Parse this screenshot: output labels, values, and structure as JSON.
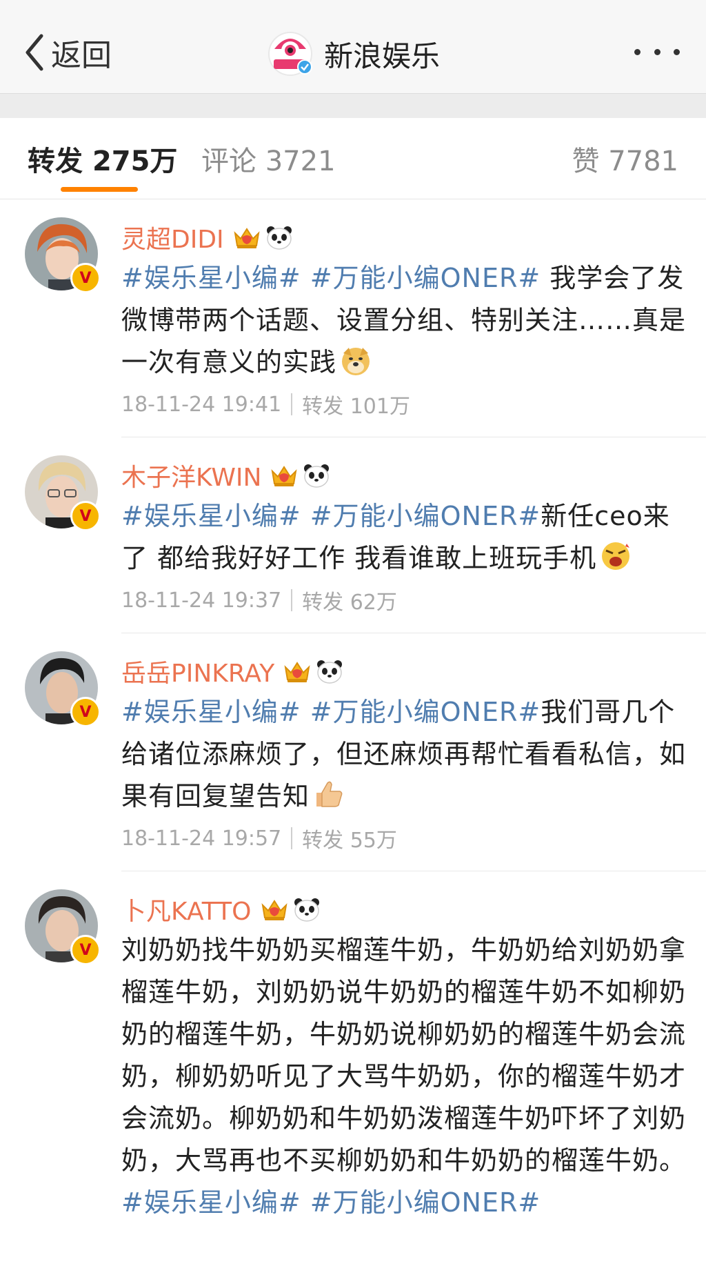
{
  "nav": {
    "back_label": "返回",
    "title": "新浪娱乐"
  },
  "tabs": {
    "repost_label": "转发",
    "repost_count": "275万",
    "comment_label": "评论",
    "comment_count": "3721",
    "like_label": "赞",
    "like_count": "7781"
  },
  "reposts": [
    {
      "name": "灵超DIDI",
      "topic1": "#娱乐星小编#",
      "topic2": "#万能小编ONER#",
      "body": " 我学会了发微博带两个话题、设置分组、特别关注……真是一次有意义的实践",
      "time": "18-11-24 19:41",
      "repost_label": "转发",
      "repost_count": "101万",
      "emoji": "doge-emoji"
    },
    {
      "name": "木子洋KWIN",
      "topic1": "#娱乐星小编#",
      "topic2": "#万能小编ONER#",
      "body": "新任ceo来了 都给我好好工作 我看谁敢上班玩手机",
      "time": "18-11-24 19:37",
      "repost_label": "转发",
      "repost_count": "62万",
      "emoji": "angry-emoji"
    },
    {
      "name": "岳岳PINKRAY",
      "topic1": "#娱乐星小编#",
      "topic2": "#万能小编ONER#",
      "body": "我们哥几个给诸位添麻烦了，但还麻烦再帮忙看看私信，如果有回复望告知",
      "time": "18-11-24 19:57",
      "repost_label": "转发",
      "repost_count": "55万",
      "emoji": "thumbs-up-emoji"
    },
    {
      "name": "卜凡KATTO",
      "body": "刘奶奶找牛奶奶买榴莲牛奶，牛奶奶给刘奶奶拿榴莲牛奶，刘奶奶说牛奶奶的榴莲牛奶不如柳奶奶的榴莲牛奶，牛奶奶说柳奶奶的榴莲牛奶会流奶，柳奶奶听见了大骂牛奶奶，你的榴莲牛奶才会流奶。柳奶奶和牛奶奶泼榴莲牛奶吓坏了刘奶奶，大骂再也不买柳奶奶和牛奶奶的榴莲牛奶。",
      "topic1": "#娱乐星小编#",
      "topic2": "#万能小编ONER#"
    }
  ],
  "colors": {
    "username": "#eb7350",
    "topic": "#507daf",
    "tab_accent": "#ff8200",
    "verified_badge": "#f7b500"
  },
  "icons": [
    "back-chevron-icon",
    "more-dots-icon",
    "crown-icon",
    "panda-icon",
    "verified-v-icon"
  ]
}
